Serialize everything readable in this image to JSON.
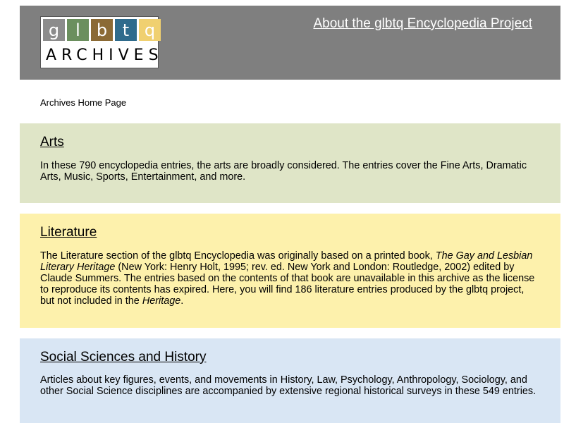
{
  "logo": {
    "letters": [
      {
        "char": "g",
        "color": "#8c8c8c"
      },
      {
        "char": "l",
        "color": "#6b8f5e"
      },
      {
        "char": "b",
        "color": "#8b6a35"
      },
      {
        "char": "t",
        "color": "#2f6b8c"
      },
      {
        "char": "q",
        "color": "#f0d070"
      }
    ],
    "word": "ARCHIVES"
  },
  "header": {
    "about_link": "About the glbtq Encyclopedia Project",
    "background": "#7f7f7f"
  },
  "breadcrumb": {
    "home": "Archives Home Page"
  },
  "sections": [
    {
      "title": "Arts",
      "description": "In these 790 encyclopedia entries, the arts are broadly considered. The entries cover the Fine Arts, Dramatic Arts, Music, Sports, Entertainment, and more.",
      "background": "#dfe5c7"
    },
    {
      "title": "Literature",
      "desc_part1": "The Literature section of the glbtq Encyclopedia was originally based on a printed book, ",
      "desc_book_title": "The Gay and Lesbian Literary Heritage",
      "desc_part2": " (New York: Henry Holt, 1995; rev. ed. New York and London: Routledge, 2002) edited by Claude Summers. The entries based on the contents of that book are unavailable in this archive as the license to reproduce its contents has expired. Here, you will find 186 literature entries produced by the glbtq project, but not included in the ",
      "desc_book_short": "Heritage",
      "desc_part3": ".",
      "background": "#fdf1ac"
    },
    {
      "title": "Social Sciences and History",
      "description": "Articles about key figures, events, and movements in History, Law, Psychology, Anthropology, Sociology, and other Social Science disciplines are accompanied by extensive regional historical surveys in these 549 entries.",
      "background": "#d9e6f4"
    }
  ]
}
